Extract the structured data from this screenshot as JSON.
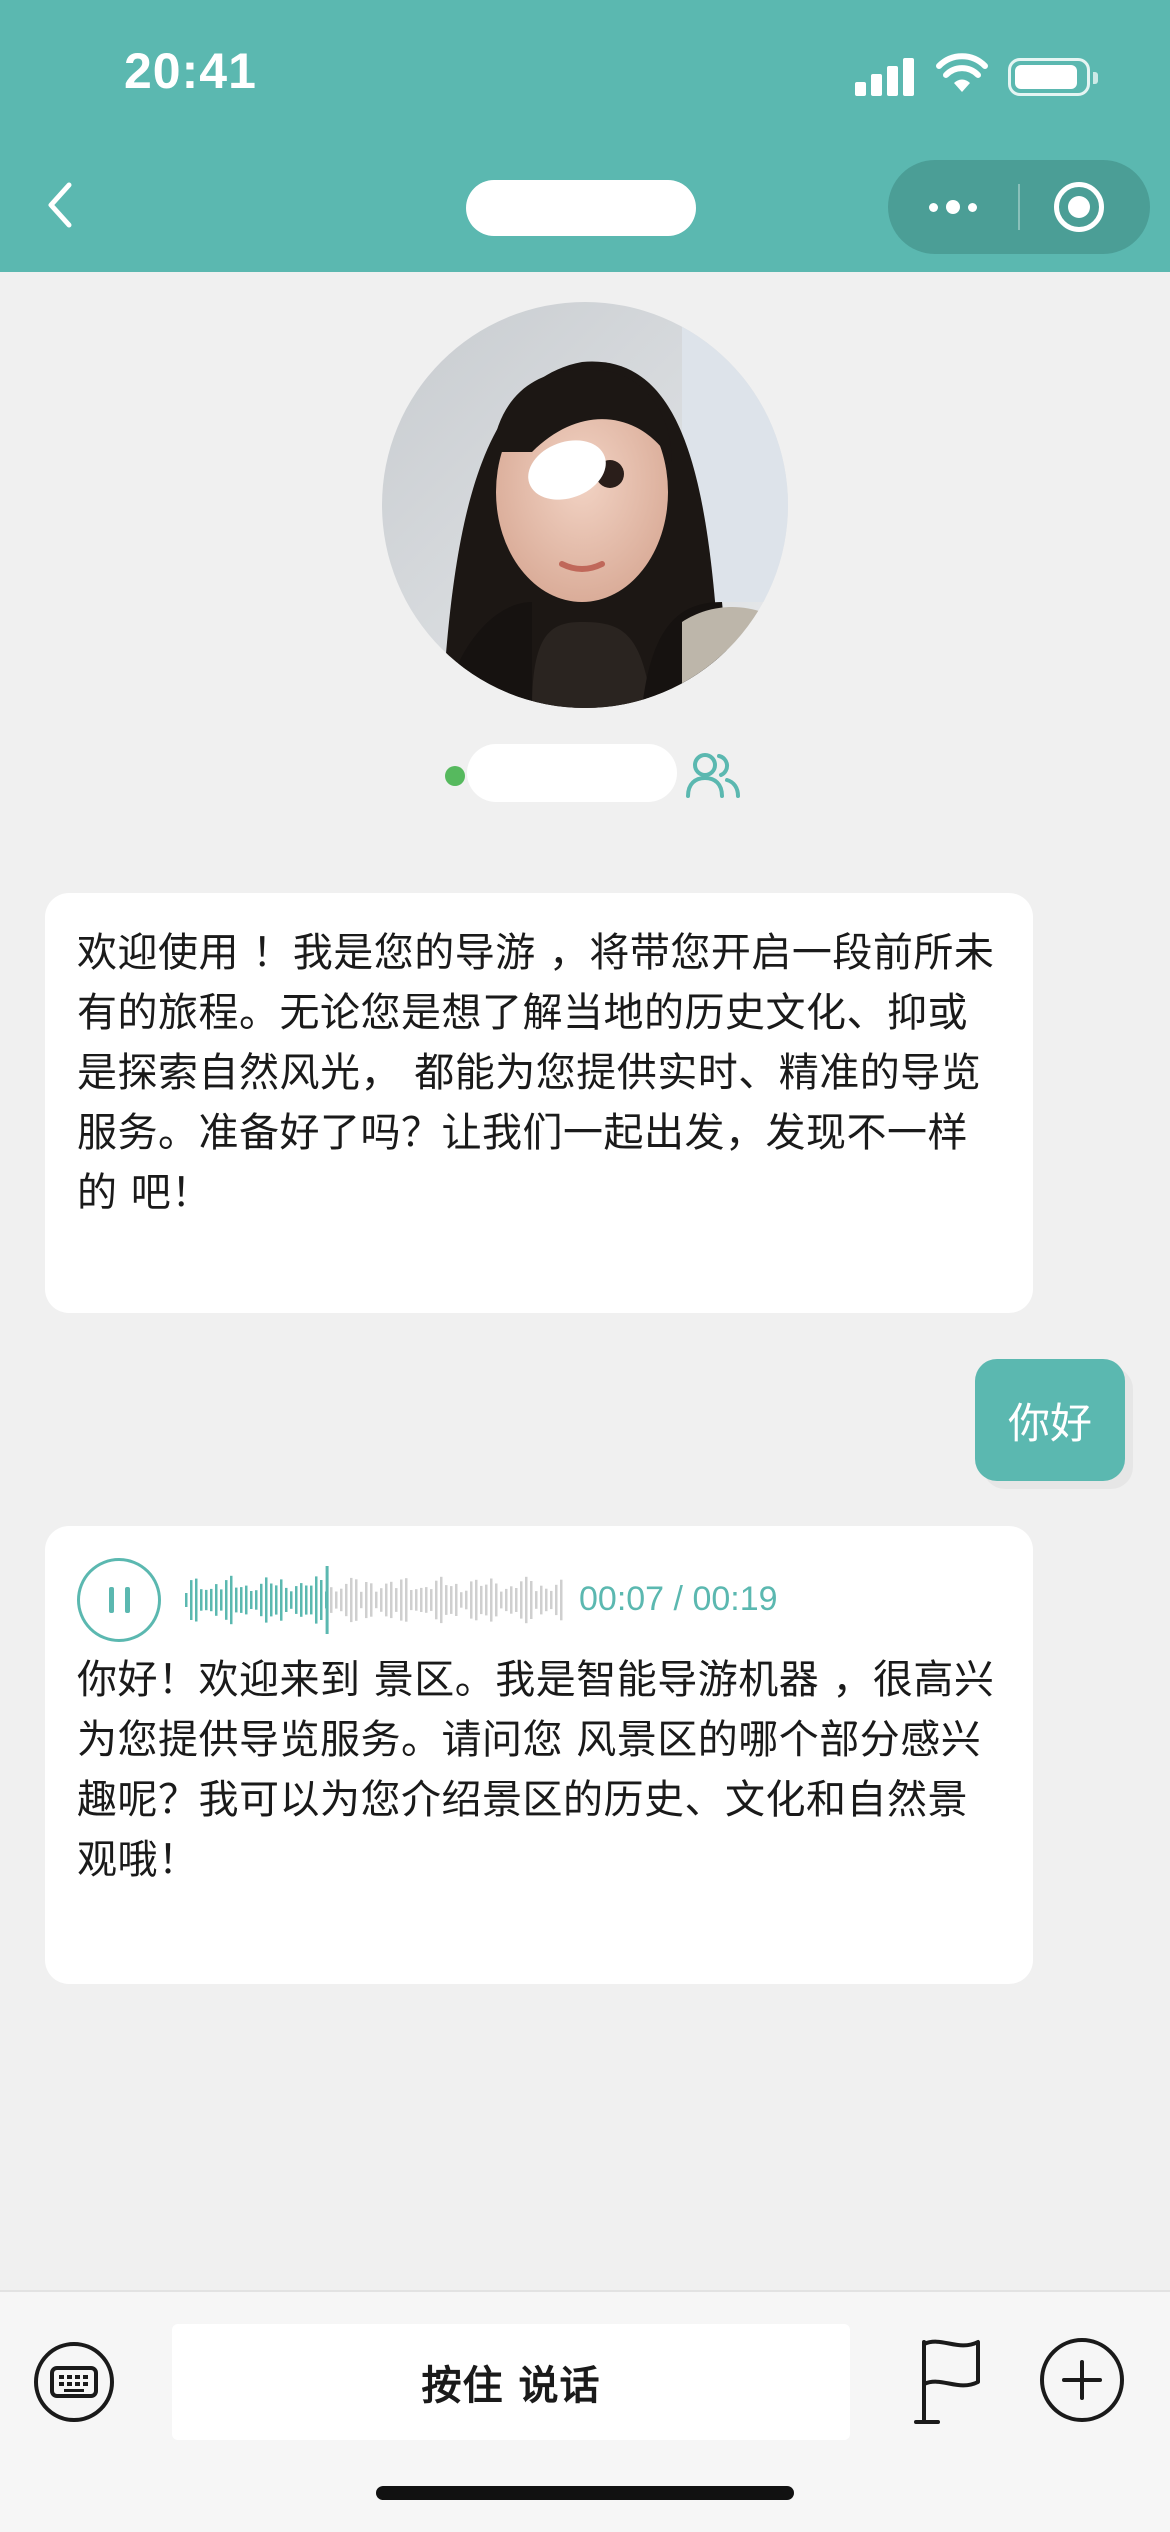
{
  "status_bar": {
    "time": "20:41"
  },
  "nav": {
    "back_icon": "chevron-left-icon",
    "more_icon": "more-dots-icon",
    "close_icon": "target-circle-icon"
  },
  "profile": {
    "online_color": "#56b95e",
    "group_icon": "people-icon"
  },
  "messages": [
    {
      "side": "left",
      "text": "欢迎使用 ！我是您的导游 ，将带您开启一段前所未有的旅程。无论您是想了解当地的历史文化、抑或是探索自然风光， 都能为您提供实时、精准的导览服务。准备好了吗？让我们一起出发，发现不一样的 吧！"
    },
    {
      "side": "right",
      "text": "你好"
    },
    {
      "side": "left",
      "audio": {
        "current": "00:07",
        "separator": " / ",
        "total": "00:19",
        "progress": 0.37,
        "state_icon": "pause-icon"
      },
      "text": "你好！欢迎来到 景区。我是智能导游机器 ，很高兴为您提供导览服务。请问您 风景区的哪个部分感兴趣呢？我可以为您介绍景区的历史、文化和自然景观哦！"
    }
  ],
  "input_bar": {
    "keyboard_icon": "keyboard-icon",
    "talk_label": "按住 说话",
    "flag_icon": "flag-icon",
    "plus_icon": "plus-circle-icon"
  },
  "colors": {
    "accent": "#5bb8b0",
    "background": "#f0f0f0",
    "bubble": "#ffffff"
  }
}
